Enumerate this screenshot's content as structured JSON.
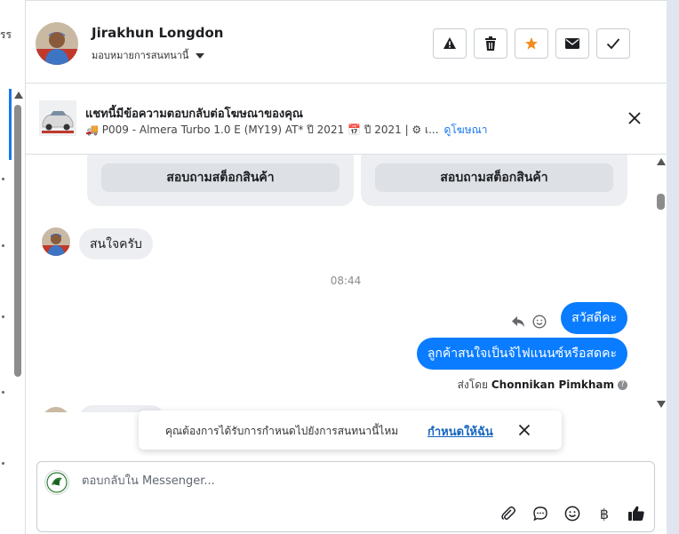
{
  "left_strip": {
    "cut_text": "รร"
  },
  "header": {
    "contact_name": "Jirakhun Longdon",
    "assign_label": "มอบหมายการสนทนานี้",
    "actions": [
      "alert-icon",
      "trash-icon",
      "star-icon",
      "mail-icon",
      "check-icon"
    ],
    "star_color": "#f28c1e"
  },
  "banner": {
    "title": "แชทนี้มีข้อความตอบกลับต่อโฆษณาของคุณ",
    "subtitle": "🚚 P009 - Almera Turbo 1.0 E (MY19) AT* ปี 2021 📅 ปี 2021 | ⚙ เ...",
    "link": "ดูโฆษณา"
  },
  "chat": {
    "cards": [
      {
        "button_label": "สอบถามสต็อกสินค้า"
      },
      {
        "button_label": "สอบถามสต็อกสินค้า"
      }
    ],
    "incoming_message": "สนใจครับ",
    "timestamp": "08:44",
    "outgoing_messages": [
      "สวัสดีคะ",
      "ลูกค้าสนใจเป็นจ้ไฟแนนซ์หรือสดคะ"
    ],
    "sent_by_prefix": "ส่งโดย",
    "sent_by_name": "Chonnikan Pimkham",
    "help_glyph": "?",
    "accent_color": "#0a7cff"
  },
  "toast": {
    "text": "คุณต้องการได้รับการกำหนดไปยังการสนทนานี้ไหม",
    "link": "กำหนดให้ฉัน"
  },
  "composer": {
    "placeholder": "ตอบกลับใน Messenger...",
    "tools": [
      "paperclip-icon",
      "chat-bubble-icon",
      "emoji-icon",
      "baht-icon",
      "thumbs-up-icon"
    ],
    "baht_glyph": "฿"
  }
}
